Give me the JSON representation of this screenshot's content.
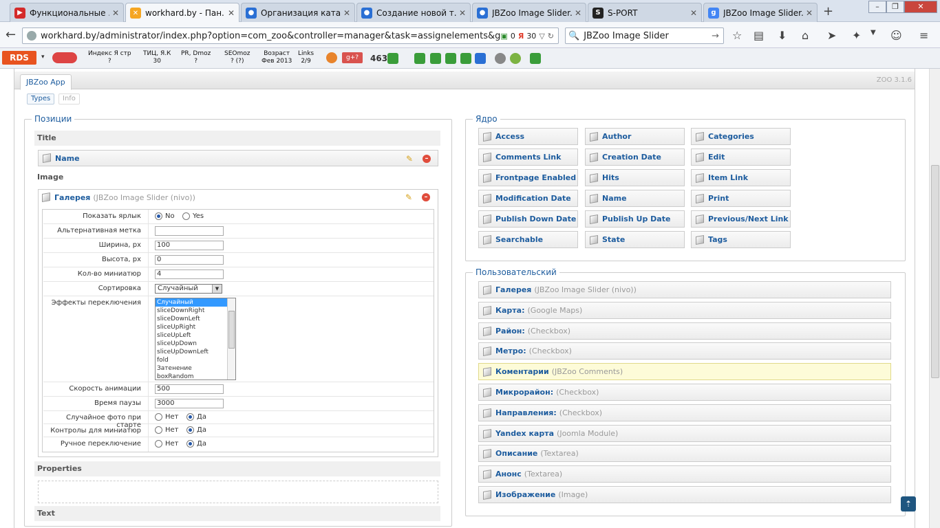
{
  "tabs": [
    {
      "title": "Функциональные ...",
      "fav_color": "#d42a2a",
      "fav_char": "▶"
    },
    {
      "title": "workhard.by - Пан...",
      "fav_color": "#f5a623",
      "fav_char": "✕",
      "active": true
    },
    {
      "title": "Организация ката...",
      "fav_color": "#2a6fd4",
      "fav_char": "●"
    },
    {
      "title": "Создание новой т...",
      "fav_color": "#2a6fd4",
      "fav_char": "●"
    },
    {
      "title": "JBZoo Image Slider...",
      "fav_color": "#2a6fd4",
      "fav_char": "●"
    },
    {
      "title": "S-PORT",
      "fav_color": "#222222",
      "fav_char": "S"
    },
    {
      "title": "JBZoo Image Slider...",
      "fav_color": "#4285f4",
      "fav_char": "g"
    }
  ],
  "address": {
    "url": "workhard.by/administrator/index.php?option=com_zoo&controller=manager&task=assignelements&group=jbuniversa",
    "badge1": "0",
    "badge2": "30"
  },
  "search": {
    "query": "JBZoo Image Slider"
  },
  "rds": {
    "label": "RDS",
    "items": [
      {
        "l1": "Индекс Я стр",
        "l2": "?"
      },
      {
        "l1": "ТИЦ, Я.К",
        "l2": "30"
      },
      {
        "l1": "PR, Dmoz",
        "l2": "?"
      },
      {
        "l1": "SEOmoz",
        "l2": "? (?)"
      },
      {
        "l1": "Возраст",
        "l2": "Фев 2013"
      },
      {
        "l1": "Links",
        "l2": "2/9"
      }
    ],
    "count": "463"
  },
  "app": {
    "tab": "JBZoo App",
    "version": "ZOO 3.1.6",
    "subtabs": [
      "Types",
      "Info"
    ]
  },
  "positions": {
    "legend": "Позиции",
    "groups": {
      "title": "Title",
      "image": "Image",
      "properties": "Properties",
      "text": "Text"
    },
    "title_element": {
      "name": "Name",
      "type": ""
    },
    "image_element": {
      "name": "Галерея",
      "type": "(JBZoo Image Slider (nivo))"
    },
    "config": {
      "show_label": {
        "label": "Показать ярлык",
        "no": "No",
        "yes": "Yes"
      },
      "alt_label": {
        "label": "Альтернативная метка",
        "value": ""
      },
      "width": {
        "label": "Ширина, px",
        "value": "100"
      },
      "height": {
        "label": "Высота, px",
        "value": "0"
      },
      "thumbs": {
        "label": "Кол-во миниатюр",
        "value": "4"
      },
      "sort": {
        "label": "Сортировка",
        "value": "Случайный"
      },
      "effects": {
        "label": "Эффекты переключения",
        "options": [
          "Случайный",
          "sliceDownRight",
          "sliceDownLeft",
          "sliceUpRight",
          "sliceUpLeft",
          "sliceUpDown",
          "sliceUpDownLeft",
          "fold",
          "Затенение",
          "boxRandom"
        ]
      },
      "anim_speed": {
        "label": "Скорость анимации",
        "value": "500"
      },
      "pause": {
        "label": "Время паузы",
        "value": "3000"
      },
      "random_start": {
        "label": "Случайное фото при старте",
        "no": "Нет",
        "yes": "Да"
      },
      "thumb_controls": {
        "label": "Контролы для миниатюр",
        "no": "Нет",
        "yes": "Да"
      },
      "manual": {
        "label": "Ручное переключение",
        "no": "Нет",
        "yes": "Да"
      }
    }
  },
  "core": {
    "legend": "Ядро",
    "items": [
      "Access",
      "Author",
      "Categories",
      "Comments Link",
      "Creation Date",
      "Edit",
      "Frontpage Enabled",
      "Hits",
      "Item Link",
      "Modification Date",
      "Name",
      "Print",
      "Publish Down Date",
      "Publish Up Date",
      "Previous/Next Link",
      "Searchable",
      "State",
      "Tags"
    ]
  },
  "custom": {
    "legend": "Пользовательский",
    "items": [
      {
        "name": "Галерея",
        "type": "(JBZoo Image Slider (nivo))"
      },
      {
        "name": "Карта:",
        "type": "(Google Maps)"
      },
      {
        "name": "Район:",
        "type": "(Checkbox)"
      },
      {
        "name": "Метро:",
        "type": "(Checkbox)"
      },
      {
        "name": "Коментарии",
        "type": "(JBZoo Comments)",
        "highlight": true
      },
      {
        "name": "Микрорайон:",
        "type": "(Checkbox)"
      },
      {
        "name": "Направления:",
        "type": "(Checkbox)"
      },
      {
        "name": "Yandex карта",
        "type": "(Joomla Module)"
      },
      {
        "name": "Описание",
        "type": "(Textarea)"
      },
      {
        "name": "Анонс",
        "type": "(Textarea)"
      },
      {
        "name": "Изображение",
        "type": "(Image)"
      }
    ]
  }
}
